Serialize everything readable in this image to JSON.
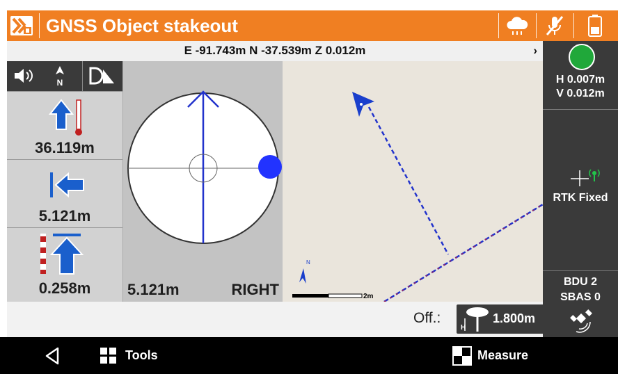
{
  "header": {
    "title": "GNSS Object stakeout"
  },
  "coord_bar": {
    "text": "E -91.743m N -37.539m Z 0.012m",
    "arrow": "›"
  },
  "left_panel": {
    "forward_value": "36.119m",
    "left_value": "5.121m",
    "height_value": "0.258m"
  },
  "compass": {
    "distance": "5.121m",
    "direction": "RIGHT"
  },
  "status": {
    "h_precision": "H 0.007m",
    "v_precision": "V 0.012m",
    "fix": "RTK Fixed",
    "bdu": "BDU 2",
    "sbas": "SBAS 0",
    "dot_color": "#20a83a"
  },
  "map": {
    "scale_label": "2m",
    "north_label": "N"
  },
  "bottom": {
    "offset_label": "Off.:",
    "antenna_height": "1.800m"
  },
  "nav": {
    "tools_label": "Tools",
    "measure_label": "Measure"
  },
  "colors": {
    "accent": "#f07f22",
    "arrow_blue": "#1a5fcc",
    "line_blue": "#2233cc"
  }
}
